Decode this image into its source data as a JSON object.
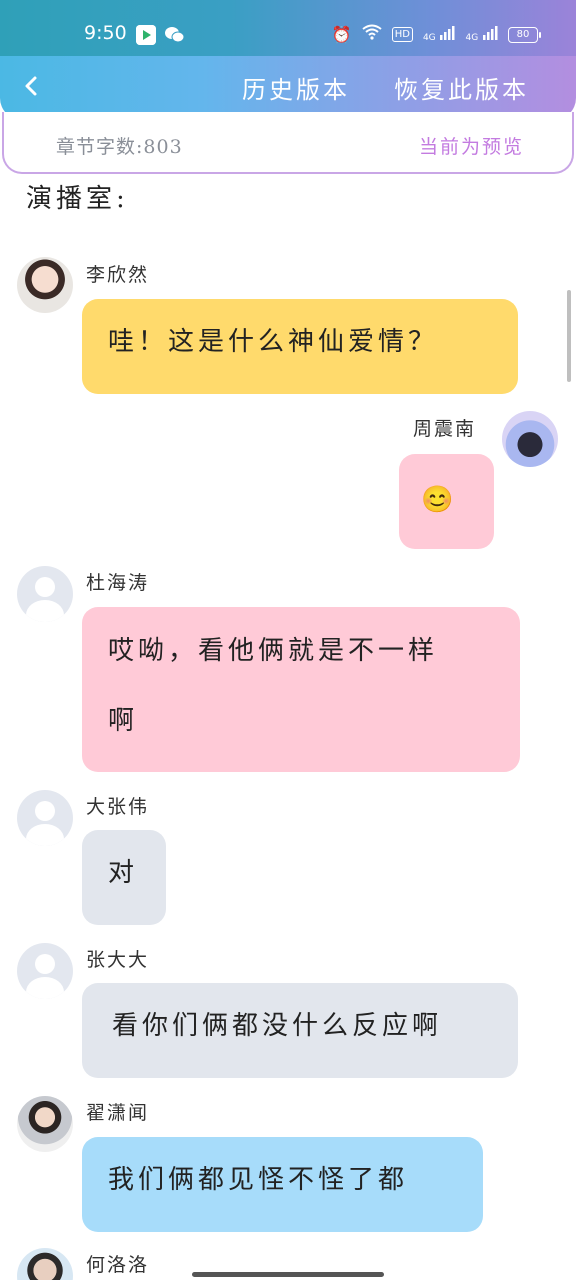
{
  "status_bar": {
    "time": "9:50",
    "network_badges": [
      "4G",
      "4G"
    ],
    "hd": "HD",
    "battery": "80"
  },
  "header": {
    "history_label": "历史版本",
    "restore_label": "恢复此版本"
  },
  "info": {
    "word_count": "章节字数:803",
    "preview_label": "当前为预览"
  },
  "room_title": "演播室:",
  "messages": [
    {
      "name": "李欣然",
      "text": "哇！这是什么神仙爱情？",
      "side": "left",
      "color": "#ffda6c"
    },
    {
      "name": "周震南",
      "text": "😊",
      "side": "right",
      "color": "#ffcad7"
    },
    {
      "name": "杜海涛",
      "text_line1": "哎呦，看他俩就是不一样",
      "text_line2": "啊",
      "side": "left",
      "color": "#ffcad7"
    },
    {
      "name": "大张伟",
      "text": "对",
      "side": "left",
      "color": "#e2e6ed"
    },
    {
      "name": "张大大",
      "text": "看你们俩都没什么反应啊",
      "side": "left",
      "color": "#e2e6ed"
    },
    {
      "name": "翟潇闻",
      "text": "我们俩都见怪不怪了都",
      "side": "left",
      "color": "#a7dcfa"
    },
    {
      "name": "何洛洛",
      "side": "left"
    }
  ]
}
